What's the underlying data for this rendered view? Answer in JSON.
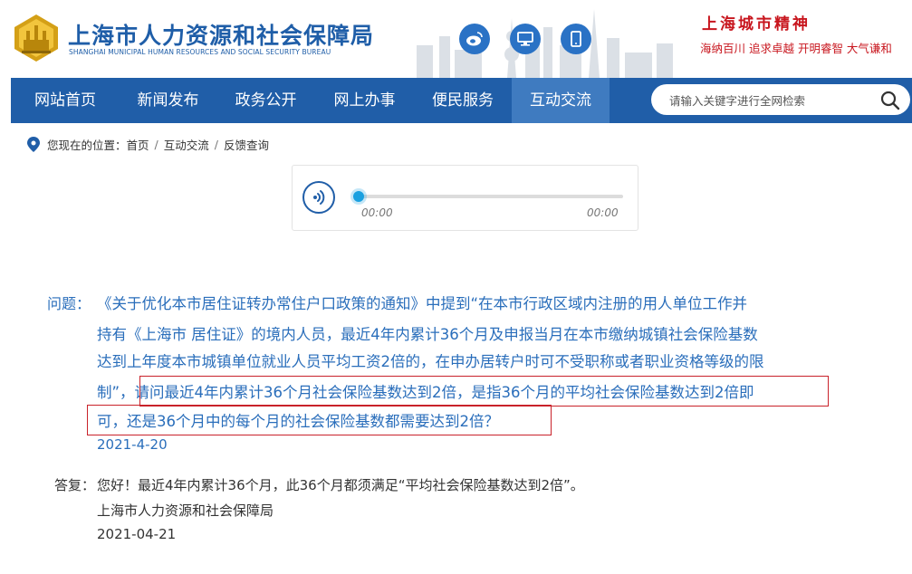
{
  "header": {
    "title": "上海市人力资源和社会保障局",
    "subtitle": "SHANGHAI MUNICIPAL HUMAN RESOURCES AND SOCIAL SECURITY BUREAU",
    "spirit_title": "上海城市精神",
    "spirit_text": "海纳百川  追求卓越  开明睿智  大气谦和"
  },
  "nav": {
    "items": [
      {
        "label": "网站首页"
      },
      {
        "label": "新闻发布"
      },
      {
        "label": "政务公开"
      },
      {
        "label": "网上办事"
      },
      {
        "label": "便民服务"
      },
      {
        "label": "互动交流"
      }
    ],
    "active_index": 5,
    "search_placeholder": "请输入关键字进行全网检索"
  },
  "breadcrumb": {
    "prefix": "您现在的位置：",
    "items": [
      "首页",
      "互动交流",
      "反馈查询"
    ]
  },
  "player": {
    "current_time": "00:00",
    "total_time": "00:00",
    "progress": 0
  },
  "question": {
    "label": "问题：",
    "lines": [
      "《关于优化本市居住证转办常住户口政策的通知》中提到“在本市行政区域内注册的用人单位工作并",
      "持有《上海市  居住证》的境内人员，最近4年内累计36个月及申报当月在本市缴纳城镇社会保险基数",
      "达到上年度本市城镇单位就业人员平均工资2倍的，在申办居转户时可不受职称或者职业资格等级的限",
      "制”，请问最近4年内累计36个月社会保险基数达到2倍，是指36个月的平均社会保险基数达到2倍即",
      "可，还是36个月中的每个月的社会保险基数都需要达到2倍？"
    ],
    "date": "2021-4-20"
  },
  "answer": {
    "label": "答复：",
    "text": "您好！最近4年内累计36个月，此36个月都须满足“平均社会保险基数达到2倍”。",
    "org": "上海市人力资源和社会保障局",
    "date": "2021-04-21"
  },
  "colors": {
    "nav_bg": "#205ea8",
    "nav_active": "#3f7bc0",
    "link_blue": "#2a6ebb",
    "highlight_red": "#c9222a",
    "spirit_red": "#c8161e"
  },
  "icons": [
    "emblem-logo",
    "weibo-icon",
    "desktop-icon",
    "mobile-icon",
    "search-icon",
    "location-pin-icon",
    "sound-wave-icon"
  ]
}
